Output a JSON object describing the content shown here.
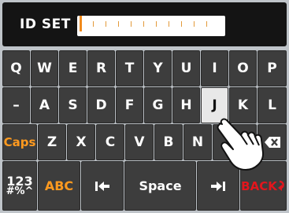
{
  "header": {
    "label": "ID SET",
    "field_value": ""
  },
  "keyboard": {
    "row1": [
      "Q",
      "W",
      "E",
      "R",
      "T",
      "Y",
      "U",
      "I",
      "O",
      "P"
    ],
    "row2": [
      "–",
      "A",
      "S",
      "D",
      "F",
      "G",
      "H",
      "J",
      "K",
      "L"
    ],
    "row3": {
      "caps": "Caps",
      "letters": [
        "Z",
        "X",
        "C",
        "V",
        "B",
        "N"
      ],
      "backspace_icon": "backspace-x-icon"
    },
    "row4": {
      "symbols_top": "123",
      "symbols_bottom": "#%^",
      "abc": "ABC",
      "left_arrow_icon": "cursor-left-icon",
      "space": "Space",
      "right_arrow_icon": "cursor-right-icon",
      "back": "BACK"
    },
    "active_key": "J"
  },
  "colors": {
    "background": "#141414",
    "key": "#3d3d3d",
    "accent_orange": "#ff9a1f",
    "back_red": "#e2161d",
    "active_key": "#e8e8e8"
  },
  "icons": {
    "pointer": "hand-pointer-icon"
  }
}
